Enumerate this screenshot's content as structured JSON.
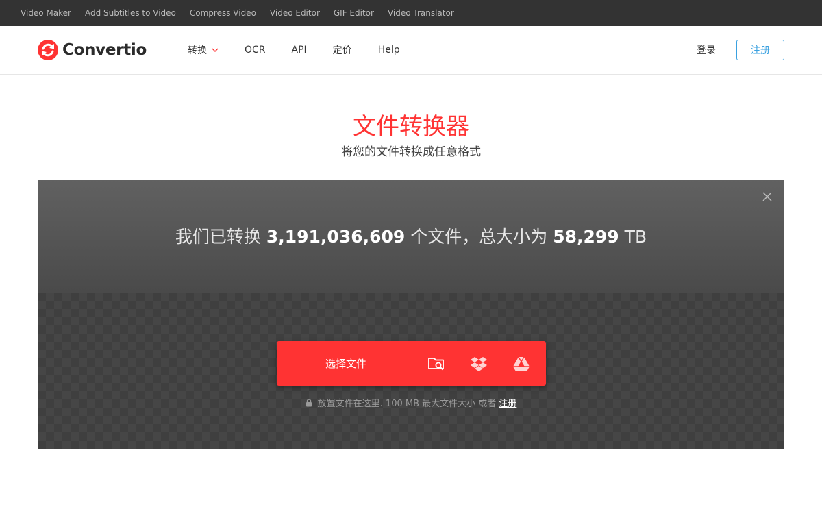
{
  "topbar": {
    "links": [
      "Video Maker",
      "Add Subtitles to Video",
      "Compress Video",
      "Video Editor",
      "GIF Editor",
      "Video Translator"
    ]
  },
  "header": {
    "logo_text": "Convertio",
    "nav": {
      "convert": "转换",
      "ocr": "OCR",
      "api": "API",
      "pricing": "定价",
      "help": "Help"
    },
    "login": "登录",
    "signup": "注册"
  },
  "hero": {
    "title": "文件转换器",
    "subtitle": "将您的文件转换成任意格式"
  },
  "stats": {
    "prefix": "我们已转换",
    "files_count": "3,191,036,609",
    "middle": "个文件，总大小为",
    "total_size": "58,299",
    "unit": "TB"
  },
  "upload": {
    "choose_files": "选择文件",
    "icons": [
      "folder-search-icon",
      "dropbox-icon",
      "google-drive-icon"
    ]
  },
  "hint": {
    "text": "放置文件在这里. 100 MB 最大文件大小 或者",
    "signup_link": "注册"
  },
  "colors": {
    "brand_red": "#ff3333",
    "signup_blue": "#3aa1e0",
    "topbar_bg": "#333333"
  }
}
